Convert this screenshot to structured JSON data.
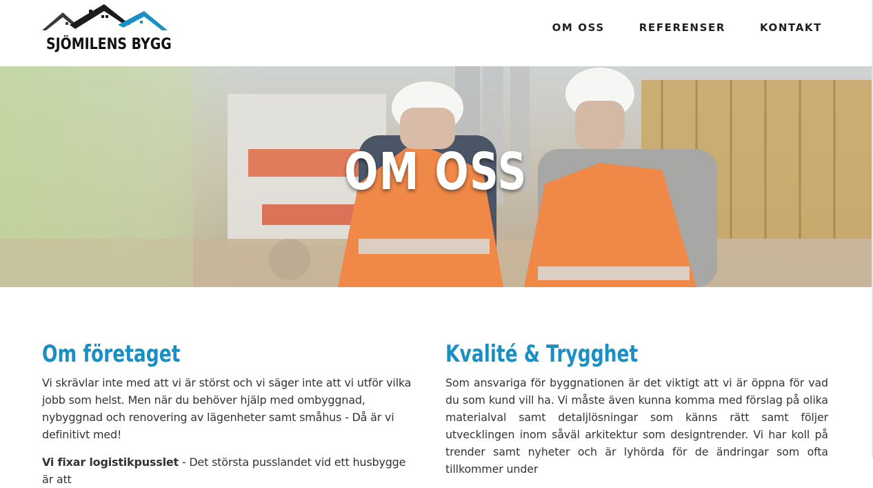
{
  "brand": {
    "name": "SJÖMILENS BYGG",
    "accent_color": "#1a8fc4"
  },
  "nav": {
    "items": [
      {
        "label": "OM OSS"
      },
      {
        "label": "REFERENSER"
      },
      {
        "label": "KONTAKT"
      }
    ]
  },
  "hero": {
    "title": "OM OSS"
  },
  "sections": {
    "left": {
      "heading": "Om företaget",
      "paragraph1": "Vi skrävlar inte med att vi är störst och vi säger inte att vi utför vilka jobb som helst. Men när du behöver hjälp med ombyggnad, nybyggnad och renovering av lägenheter samt småhus - Då är vi definitivt med!",
      "paragraph2_bold": "Vi fixar logistikpusslet",
      "paragraph2_rest": " - Det största pusslandet vid ett husbygge är att"
    },
    "right": {
      "heading": "Kvalité & Trygghet",
      "paragraph1": "Som ansvariga för byggnationen är det viktigt att vi är öppna för vad du som kund vill ha. Vi måste även kunna komma med förslag på olika materialval samt detaljlösningar som känns rätt samt följer utvecklingen inom såväl arkitektur som designtrender. Vi har koll på trender samt nyheter och är lyhörda för de ändringar som ofta tillkommer under"
    }
  }
}
